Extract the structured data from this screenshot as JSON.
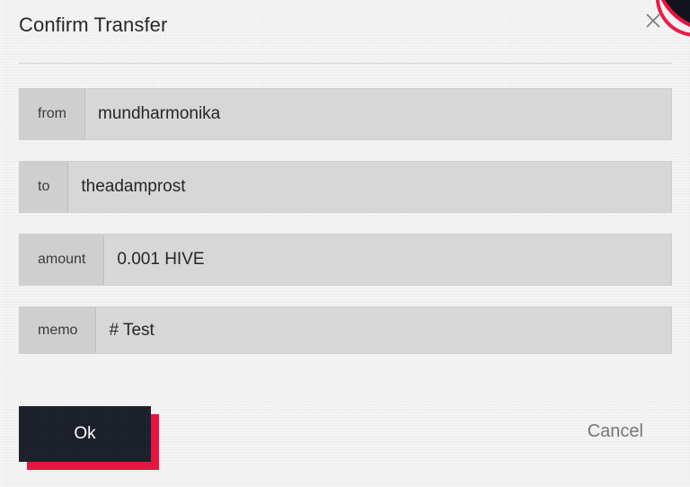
{
  "dialog": {
    "title": "Confirm Transfer",
    "close_icon": "close-icon",
    "background_color": "#f1f1f1"
  },
  "fields": [
    {
      "label": "from",
      "value": "mundharmonika"
    },
    {
      "label": "to",
      "value": "theadamprost"
    },
    {
      "label": "amount",
      "value": "0.001 HIVE"
    },
    {
      "label": "memo",
      "value": "# Test"
    }
  ],
  "footer": {
    "ok_label": "Ok",
    "cancel_label": "Cancel",
    "ok_background_color": "#1b1f2b",
    "ok_shadow_color": "#e8133f",
    "cancel_text_color": "#73767c"
  }
}
